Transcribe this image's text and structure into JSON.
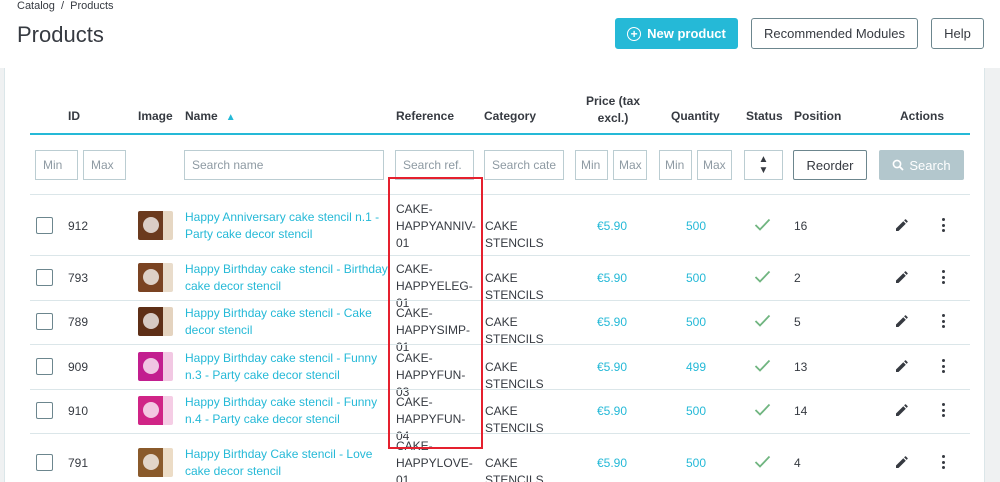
{
  "breadcrumb": {
    "catalog": "Catalog",
    "separator": "/",
    "products": "Products"
  },
  "page_title": "Products",
  "toolbar": {
    "new_product": "New product",
    "recommended_modules": "Recommended Modules",
    "help": "Help"
  },
  "columns": {
    "id": "ID",
    "image": "Image",
    "name": "Name",
    "reference": "Reference",
    "category": "Category",
    "price_line1": "Price (tax",
    "price_line2": "excl.)",
    "quantity": "Quantity",
    "status": "Status",
    "position": "Position",
    "actions": "Actions"
  },
  "filters": {
    "id_min": "Min",
    "id_max": "Max",
    "name": "Search name",
    "reference": "Search ref.",
    "category": "Search cate",
    "price_min": "Min",
    "price_max": "Max",
    "qty_min": "Min",
    "qty_max": "Max",
    "reorder": "Reorder",
    "search": "Search"
  },
  "rows": [
    {
      "id": "912",
      "name1": "Happy Anniversary cake stencil n.1 -",
      "name2": "Party cake decor stencil",
      "ref1": "CAKE-",
      "ref2": "HAPPYANNIV-",
      "ref3": "01",
      "category": "CAKE STENCILS",
      "price": "€5.90",
      "quantity": "500",
      "position": "16",
      "thumb_color": "#6b3a1e",
      "band_color": "#e6d7c3"
    },
    {
      "id": "793",
      "name1": "Happy Birthday cake stencil - Birthday",
      "name2": "cake decor stencil",
      "ref1": "CAKE-",
      "ref2": "HAPPYELEG-01",
      "ref3": "",
      "category": "CAKE STENCILS",
      "price": "€5.90",
      "quantity": "500",
      "position": "2",
      "thumb_color": "#7a4322",
      "band_color": "#e9dccb"
    },
    {
      "id": "789",
      "name1": "Happy Birthday cake stencil - Cake",
      "name2": "decor stencil",
      "ref1": "CAKE-",
      "ref2": "HAPPYSIMP-01",
      "ref3": "",
      "category": "CAKE STENCILS",
      "price": "€5.90",
      "quantity": "500",
      "position": "5",
      "thumb_color": "#5e2f17",
      "band_color": "#e4d3bf"
    },
    {
      "id": "909",
      "name1": "Happy Birthday cake stencil - Funny",
      "name2": "n.3 - Party cake decor stencil",
      "ref1": "CAKE-",
      "ref2": "HAPPYFUN-03",
      "ref3": "",
      "category": "CAKE STENCILS",
      "price": "€5.90",
      "quantity": "499",
      "position": "13",
      "thumb_color": "#c21e8f",
      "band_color": "#f2c8e3"
    },
    {
      "id": "910",
      "name1": "Happy Birthday cake stencil - Funny",
      "name2": "n.4 - Party cake decor stencil",
      "ref1": "CAKE-",
      "ref2": "HAPPYFUN-04",
      "ref3": "",
      "category": "CAKE STENCILS",
      "price": "€5.90",
      "quantity": "500",
      "position": "14",
      "thumb_color": "#d02486",
      "band_color": "#f5cde5"
    },
    {
      "id": "791",
      "name1": "Happy Birthday Cake stencil - Love",
      "name2": "cake decor stencil",
      "ref1": "CAKE-",
      "ref2": "HAPPYLOVE-",
      "ref3": "01",
      "category": "CAKE STENCILS",
      "price": "€5.90",
      "quantity": "500",
      "position": "4",
      "thumb_color": "#8a5a2b",
      "band_color": "#ecdcc6"
    }
  ],
  "colors": {
    "accent": "#25b9d7",
    "highlight": "#e5202e",
    "status_ok": "#70b580"
  }
}
